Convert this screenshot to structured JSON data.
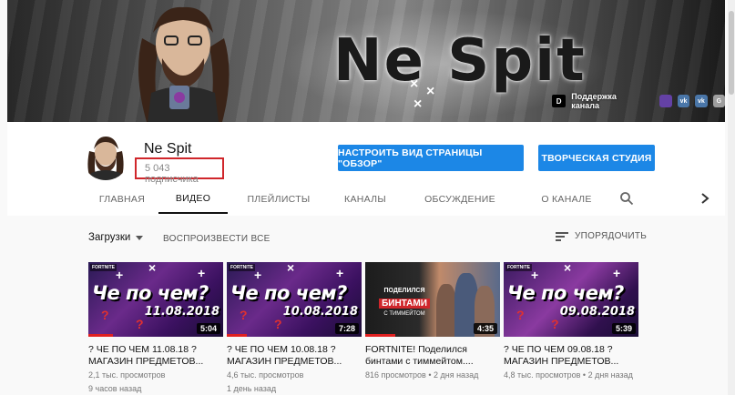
{
  "banner": {
    "title": "Ne Spit",
    "link_label": "Поддержка канала",
    "link_logo": "D",
    "social_icons": [
      {
        "name": "twitch-icon",
        "text": "",
        "color": "#6441a5"
      },
      {
        "name": "vk-icon",
        "text": "vk",
        "color": "#4a76a8"
      },
      {
        "name": "vk-icon-2",
        "text": "vk",
        "color": "#4a76a8"
      },
      {
        "name": "google-icon",
        "text": "G",
        "color": "#9e9e9e"
      }
    ]
  },
  "channel": {
    "name": "Ne Spit",
    "subscribers": "5 043 подписчика",
    "customize_button": "НАСТРОИТЬ ВИД СТРАНИЦЫ \"ОБЗОР\"",
    "studio_button": "ТВОРЧЕСКАЯ СТУДИЯ"
  },
  "tabs": [
    "ГЛАВНАЯ",
    "ВИДЕО",
    "ПЛЕЙЛИСТЫ",
    "КАНАЛЫ",
    "ОБСУЖДЕНИЕ",
    "О КАНАЛЕ"
  ],
  "active_tab": "ВИДЕО",
  "sortbar": {
    "uploads": "Загрузки",
    "play_all": "ВОСПРОИЗВЕСТИ ВСЕ",
    "sort": "УПОРЯДОЧИТЬ"
  },
  "videos": [
    {
      "thumb_text": "Че по чем?",
      "thumb_date": "11.08.2018",
      "thumb_tag": "FORTNITE",
      "duration": "5:04",
      "watched_fraction": 0.18,
      "title": "? ЧЕ ПО ЧЕМ 11.08.18 ? МАГАЗИН ПРЕДМЕТОВ...",
      "views": "2,1 тыс. просмотров",
      "age": "9 часов назад"
    },
    {
      "thumb_text": "Че по чем?",
      "thumb_date": "10.08.2018",
      "thumb_tag": "FORTNITE",
      "duration": "7:28",
      "watched_fraction": 0.15,
      "title": "? ЧЕ ПО ЧЕМ 10.08.18 ? МАГАЗИН ПРЕДМЕТОВ...",
      "views": "4,6 тыс. просмотров",
      "age": "1 день назад"
    },
    {
      "thumb_line1": "ПОДЕЛИЛСЯ",
      "thumb_line2": "БИНТАМИ",
      "thumb_line3": "С ТИММЕЙТОМ",
      "duration": "4:35",
      "watched_fraction": 0.22,
      "title": "FORTNITE! Поделился бинтами с тиммейтом....",
      "views": "816 просмотров",
      "age": "2 дня назад"
    },
    {
      "thumb_text": "Че по чем?",
      "thumb_date": "09.08.2018",
      "thumb_tag": "FORTNITE",
      "duration": "5:39",
      "watched_fraction": 0.0,
      "title": "? ЧЕ ПО ЧЕМ 09.08.18 ? МАГАЗИН ПРЕДМЕТОВ...",
      "views": "4,8 тыс. просмотров",
      "age": "2 дня назад"
    }
  ]
}
